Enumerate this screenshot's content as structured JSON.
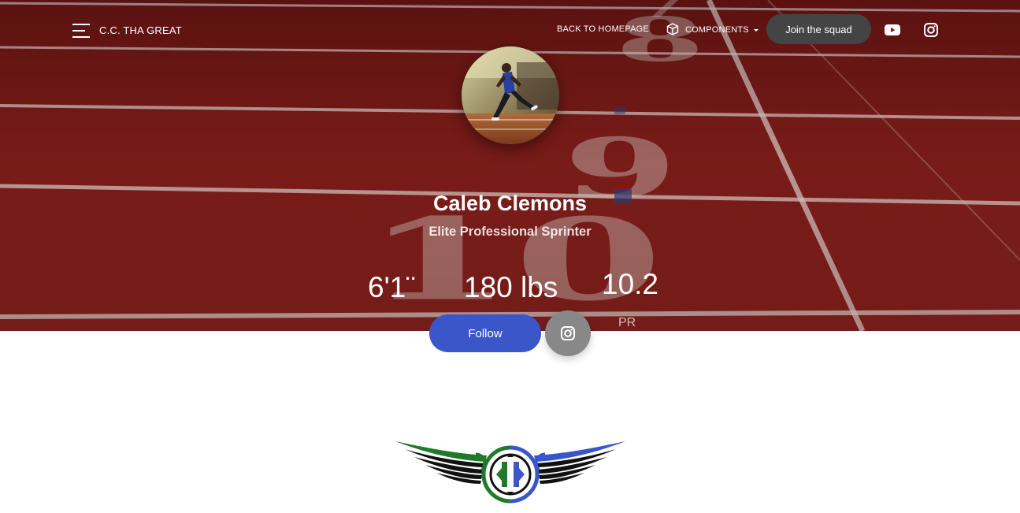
{
  "navbar": {
    "brand": "C.C. THA GREAT",
    "back_link": "BACK TO HOMEPAGE",
    "components_link": "COMPONENTS",
    "join_button": "Join the squad",
    "icons": [
      "menu-icon",
      "box-icon",
      "youtube-icon",
      "instagram-icon"
    ]
  },
  "profile": {
    "name": "Caleb Clemons",
    "title": "Elite Professional Sprinter",
    "stats": {
      "height": "6'1¨",
      "weight": "180 lbs",
      "pr_value": "10.2",
      "pr_label": "PR"
    },
    "follow_button": "Follow",
    "social_icon": "instagram-icon"
  },
  "colors": {
    "hero_track": "#7d1c19",
    "follow_button": "#3a56c9",
    "join_button": "#444444",
    "social_button": "#888888",
    "logo_green": "#1f7a2a",
    "logo_blue": "#3a56c9"
  }
}
